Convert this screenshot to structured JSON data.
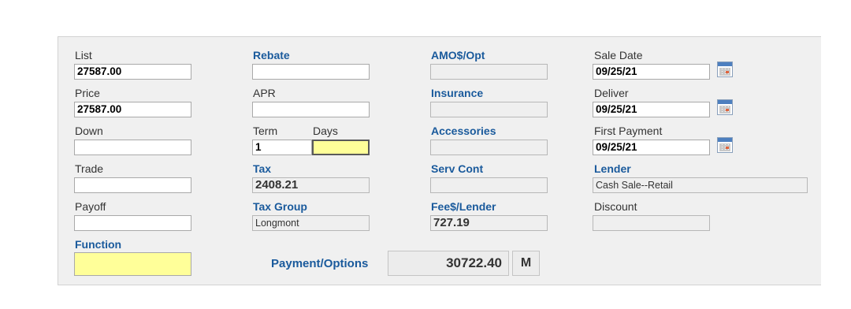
{
  "col1": {
    "list": {
      "label": "List",
      "value": "27587.00"
    },
    "price": {
      "label": "Price",
      "value": "27587.00"
    },
    "down": {
      "label": "Down",
      "value": ""
    },
    "trade": {
      "label": "Trade",
      "value": ""
    },
    "payoff": {
      "label": "Payoff",
      "value": ""
    },
    "function": {
      "label": "Function",
      "value": ""
    }
  },
  "col2": {
    "rebate": {
      "label": "Rebate",
      "value": ""
    },
    "apr": {
      "label": "APR",
      "value": ""
    },
    "term": {
      "label": "Term",
      "value": "1"
    },
    "days": {
      "label": "Days",
      "value": ""
    },
    "tax": {
      "label": "Tax",
      "value": "2408.21"
    },
    "tax_group": {
      "label": "Tax Group",
      "value": "Longmont"
    }
  },
  "col3": {
    "amo_opt": {
      "label": "AMO$/Opt",
      "value": ""
    },
    "insurance": {
      "label": "Insurance",
      "value": ""
    },
    "accessories": {
      "label": "Accessories",
      "value": ""
    },
    "serv_cont": {
      "label": "Serv Cont",
      "value": ""
    },
    "fee_lender": {
      "label": "Fee$/Lender",
      "value": "727.19"
    }
  },
  "col4": {
    "sale_date": {
      "label": "Sale Date",
      "value": "09/25/21"
    },
    "deliver": {
      "label": "Deliver",
      "value": "09/25/21"
    },
    "first_payment": {
      "label": "First Payment",
      "value": "09/25/21"
    },
    "lender": {
      "label": "Lender",
      "value": "Cash Sale--Retail"
    },
    "discount": {
      "label": "Discount",
      "value": ""
    }
  },
  "payment": {
    "label": "Payment/Options",
    "total": "30722.40",
    "mode": "M"
  },
  "icons": {
    "calendar": "calendar-icon"
  },
  "colors": {
    "link": "#1a5a9c",
    "highlight": "#ffff99",
    "panel": "#f0f0f0"
  }
}
